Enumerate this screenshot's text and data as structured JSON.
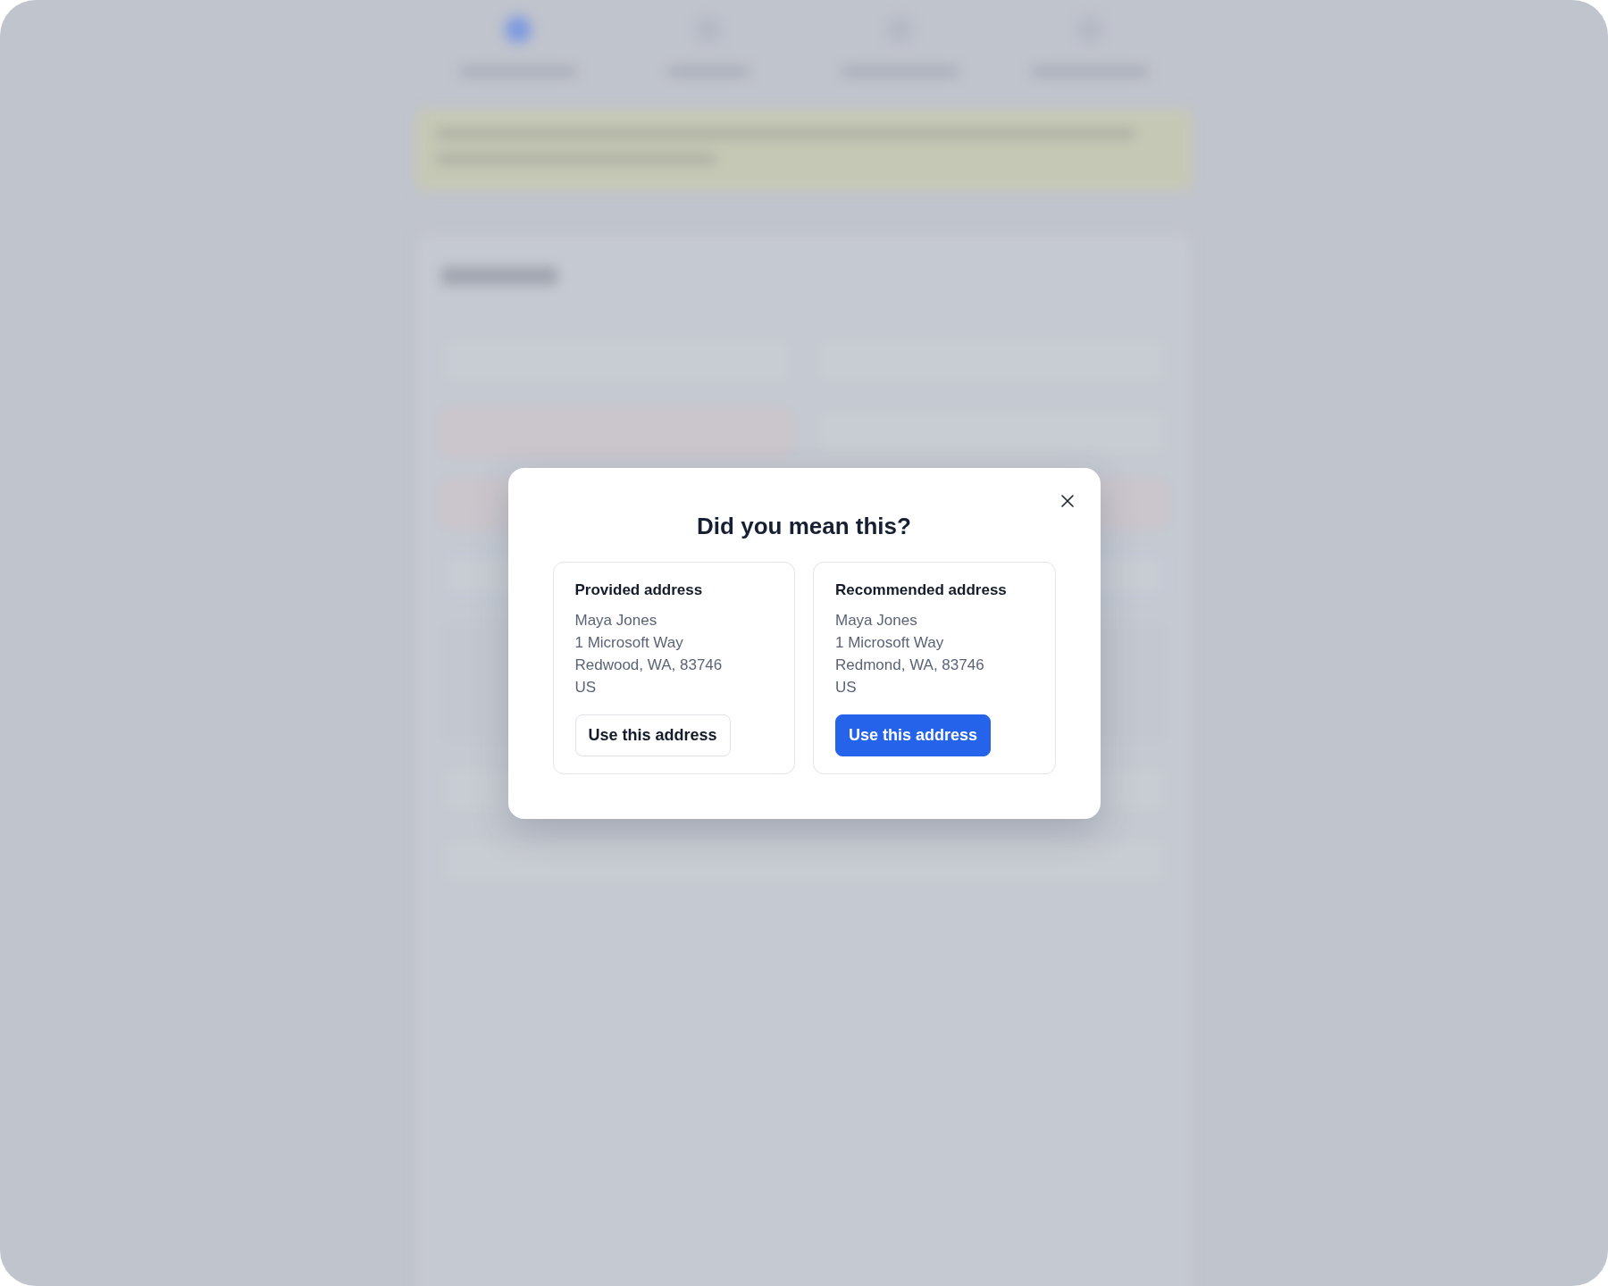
{
  "dialog": {
    "title": "Did you mean this?",
    "options": [
      {
        "heading": "Provided address",
        "lines": [
          "Maya Jones",
          "1 Microsoft Way",
          "Redwood, WA, 83746",
          "US"
        ],
        "button": {
          "label": "Use this address",
          "primary": false
        }
      },
      {
        "heading": "Recommended address",
        "lines": [
          "Maya Jones",
          "1 Microsoft Way",
          "Redmond, WA, 83746",
          "US"
        ],
        "button": {
          "label": "Use this address",
          "primary": true
        }
      }
    ]
  }
}
